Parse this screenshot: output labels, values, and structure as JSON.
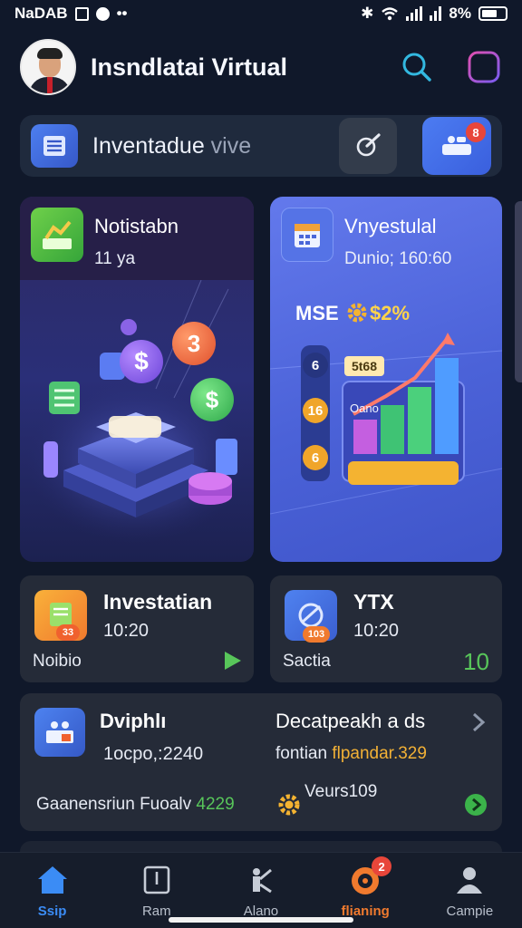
{
  "status_bar": {
    "left_text": "NaDAB",
    "battery": "8%"
  },
  "header": {
    "title": "Insndlatai Virtual"
  },
  "search": {
    "text_main": "Inventadue",
    "text_dim": " vive",
    "notify_count": "8"
  },
  "cards": {
    "left": {
      "title": "Notistabn",
      "subtitle": "11 ya",
      "coins": [
        "$",
        "3",
        "$"
      ]
    },
    "right": {
      "title": "Vnyestulal",
      "subtitle": "Dunio; 160:60",
      "mse_label": "MSE",
      "mse_value": "$2%",
      "pill_label": "5t68",
      "chart_label": "Oano",
      "side_buttons": [
        "6",
        "16",
        "6"
      ]
    }
  },
  "small_cards": [
    {
      "title": "Investatian",
      "time": "10:20",
      "label": "Noibio",
      "badge": "33"
    },
    {
      "title": "YTX",
      "time": "10:20",
      "label": "Sactia",
      "count": "10",
      "badge": "103"
    }
  ],
  "wide_card": {
    "title": "Dviphlı",
    "value": "1ocpo,:2240",
    "title2": "Decatpeakh a ds",
    "sub2_plain": "fontian ",
    "sub2_highlight": "flpandar.329",
    "bottom_text": "Gaanensriun Fuoalv ",
    "bottom_value": "4229",
    "bottom_right": "Veurs109"
  },
  "nav": [
    {
      "label": "Ssip",
      "icon": "home-icon",
      "active": true
    },
    {
      "label": "Ram",
      "icon": "document-icon"
    },
    {
      "label": "Alano",
      "icon": "chart-person-icon"
    },
    {
      "label": "flianing",
      "icon": "target-icon",
      "badge": "2"
    },
    {
      "label": "Campie",
      "icon": "person-icon"
    }
  ],
  "colors": {
    "accent": "#3b8cf5",
    "green": "#58c65a",
    "orange": "#f07a2e",
    "badge_red": "#e8463a"
  }
}
